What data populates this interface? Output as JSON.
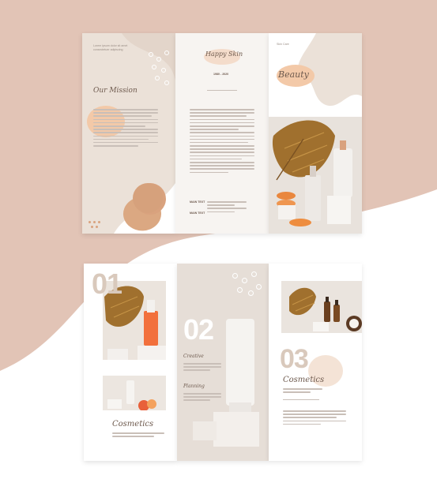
{
  "colors": {
    "background_pink": "#e2c4b6",
    "panel_cream": "#eee4dc",
    "accent_peach": "#f3c9a8",
    "text_brown": "#6e5a4e",
    "number_beige": "#d9c9bc"
  },
  "front": {
    "left": {
      "mission_title": "Our Mission"
    },
    "middle": {
      "logo": "Happy Skin",
      "years": "1980 - 2020",
      "main_text_1": "MAIN TEXT",
      "main_text_2": "MAIN TEXT"
    },
    "right": {
      "tag": "Skin Care",
      "title": "Beauty"
    }
  },
  "inside": {
    "panel1": {
      "number": "01",
      "title": "Cosmetics"
    },
    "panel2": {
      "number": "02",
      "subtitle_1": "Creative",
      "subtitle_2": "Planning"
    },
    "panel3": {
      "number": "03",
      "title": "Cosmetics"
    }
  }
}
